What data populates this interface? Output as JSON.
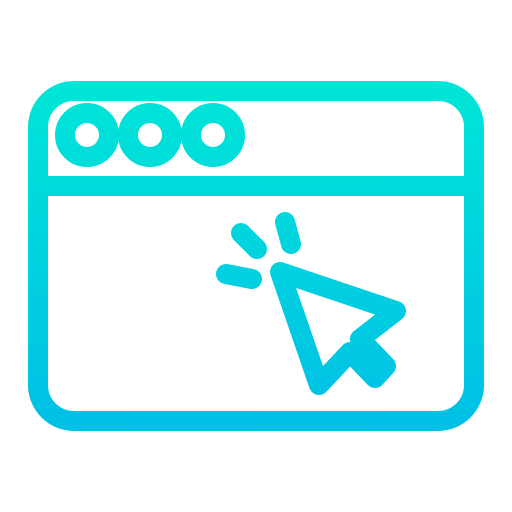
{
  "icon": {
    "name": "browser-window-click-icon",
    "gradient_top": "#00e6d7",
    "gradient_bottom": "#00bfe6"
  }
}
